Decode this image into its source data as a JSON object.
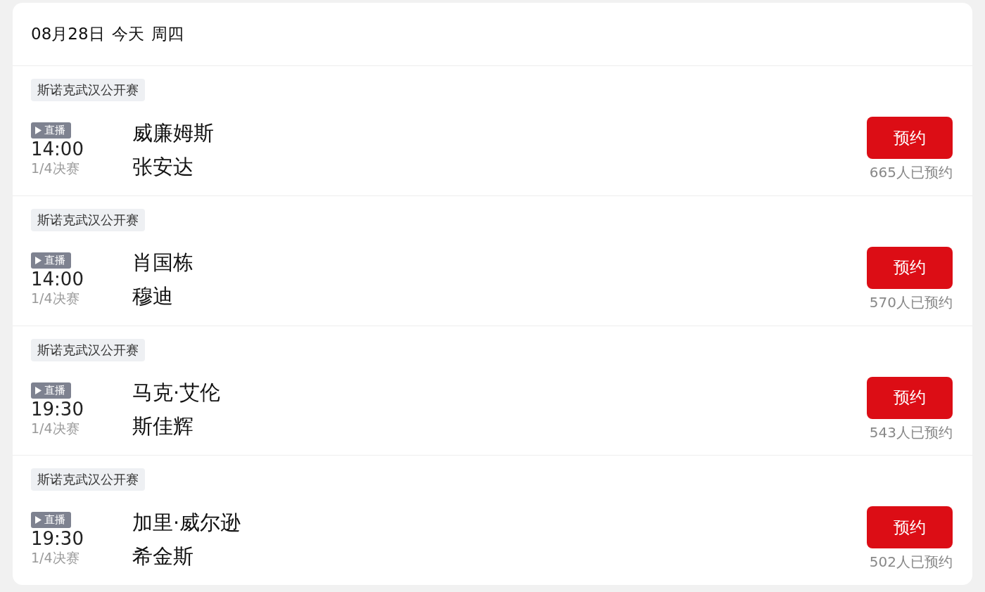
{
  "date_header": {
    "date": "08月28日",
    "day_label": "今天",
    "weekday": "周四"
  },
  "matches": [
    {
      "tournament": "斯诺克武汉公开赛",
      "live_badge": "直播",
      "time": "14:00",
      "stage": "1/4决赛",
      "players": [
        "威廉姆斯",
        "张安达"
      ],
      "button": "预约",
      "booked_count": "665人已预约"
    },
    {
      "tournament": "斯诺克武汉公开赛",
      "live_badge": "直播",
      "time": "14:00",
      "stage": "1/4决赛",
      "players": [
        "肖国栋",
        "穆迪"
      ],
      "button": "预约",
      "booked_count": "570人已预约"
    },
    {
      "tournament": "斯诺克武汉公开赛",
      "live_badge": "直播",
      "time": "19:30",
      "stage": "1/4决赛",
      "players": [
        "马克·艾伦",
        "斯佳辉"
      ],
      "button": "预约",
      "booked_count": "543人已预约"
    },
    {
      "tournament": "斯诺克武汉公开赛",
      "live_badge": "直播",
      "time": "19:30",
      "stage": "1/4决赛",
      "players": [
        "加里·威尔逊",
        "希金斯"
      ],
      "button": "预约",
      "booked_count": "502人已预约"
    }
  ]
}
